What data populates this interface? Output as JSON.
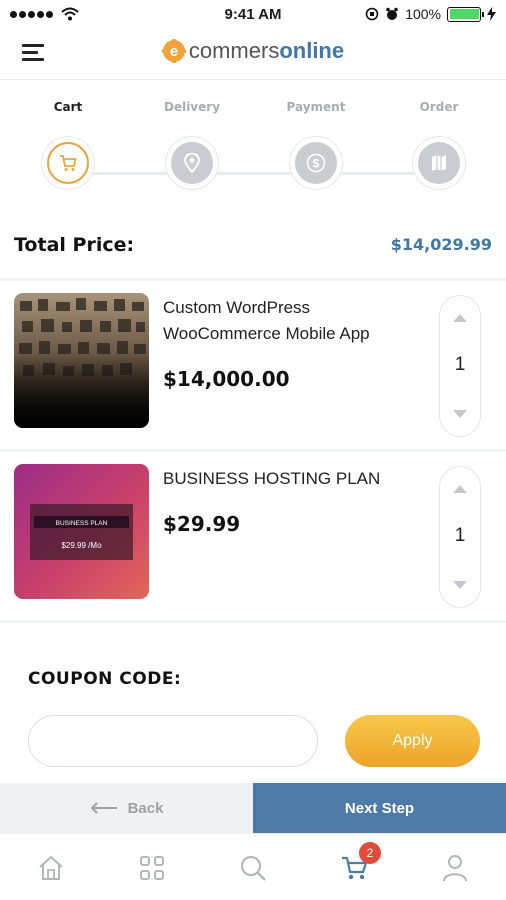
{
  "status_bar": {
    "time": "9:41 AM",
    "battery": "100%"
  },
  "header": {
    "logo_prefix": "commers",
    "logo_suffix": "online",
    "logo_letter": "e"
  },
  "steps": [
    {
      "label": "Cart",
      "icon": "cart-icon",
      "active": true
    },
    {
      "label": "Delivery",
      "icon": "location-pin-icon",
      "active": false
    },
    {
      "label": "Payment",
      "icon": "dollar-icon",
      "active": false
    },
    {
      "label": "Order",
      "icon": "map-icon",
      "active": false
    }
  ],
  "total": {
    "label": "Total Price:",
    "value": "$14,029.99"
  },
  "items": [
    {
      "title": "Custom WordPress WooCommerce Mobile App",
      "price": "$14,000.00",
      "qty": "1"
    },
    {
      "title": "BUSINESS HOSTING PLAN",
      "price": "$29.99",
      "qty": "1",
      "thumb_title": "BUSINESS PLAN",
      "thumb_price": "$29.99 /Mo"
    }
  ],
  "coupon": {
    "label": "COUPON CODE:",
    "placeholder": "",
    "apply_label": "Apply"
  },
  "nav_buttons": {
    "back_label": "Back",
    "next_label": "Next Step"
  },
  "tabbar": {
    "cart_badge": "2"
  },
  "colors": {
    "accent_orange": "#f0a23b",
    "brand_blue": "#3f77a8",
    "next_button": "#4d7ba6",
    "badge_red": "#e04b3a"
  }
}
